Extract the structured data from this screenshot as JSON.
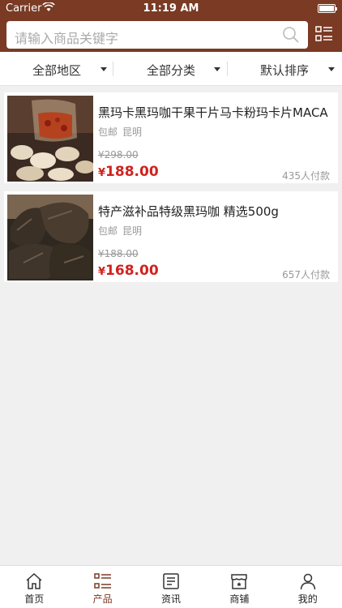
{
  "status_bar": {
    "carrier": "Carrier",
    "time": "11:19 AM"
  },
  "search": {
    "placeholder": "请输入商品关键字"
  },
  "filters": [
    {
      "label": "全部地区"
    },
    {
      "label": "全部分类"
    },
    {
      "label": "默认排序"
    }
  ],
  "products": [
    {
      "title": "黑玛卡黑玛咖干果干片马卡粉玛卡片MACA",
      "shipping": "包邮",
      "location": "昆明",
      "old_price": "¥298.00",
      "currency": "¥",
      "price": "188.00",
      "sold": "435人付款"
    },
    {
      "title": "特产滋补品特级黑玛咖 精选500g",
      "shipping": "包邮",
      "location": "昆明",
      "old_price": "¥188.00",
      "currency": "¥",
      "price": "168.00",
      "sold": "657人付款"
    }
  ],
  "tabbar": {
    "active": "产品",
    "tabs": [
      {
        "label": "首页",
        "icon": "home-icon"
      },
      {
        "label": "产品",
        "icon": "list-icon"
      },
      {
        "label": "资讯",
        "icon": "news-icon"
      },
      {
        "label": "商铺",
        "icon": "shop-icon"
      },
      {
        "label": "我的",
        "icon": "user-icon"
      }
    ]
  },
  "colors": {
    "brand": "#7a3a24",
    "price": "#d0221e",
    "background": "#f0f0f0"
  }
}
